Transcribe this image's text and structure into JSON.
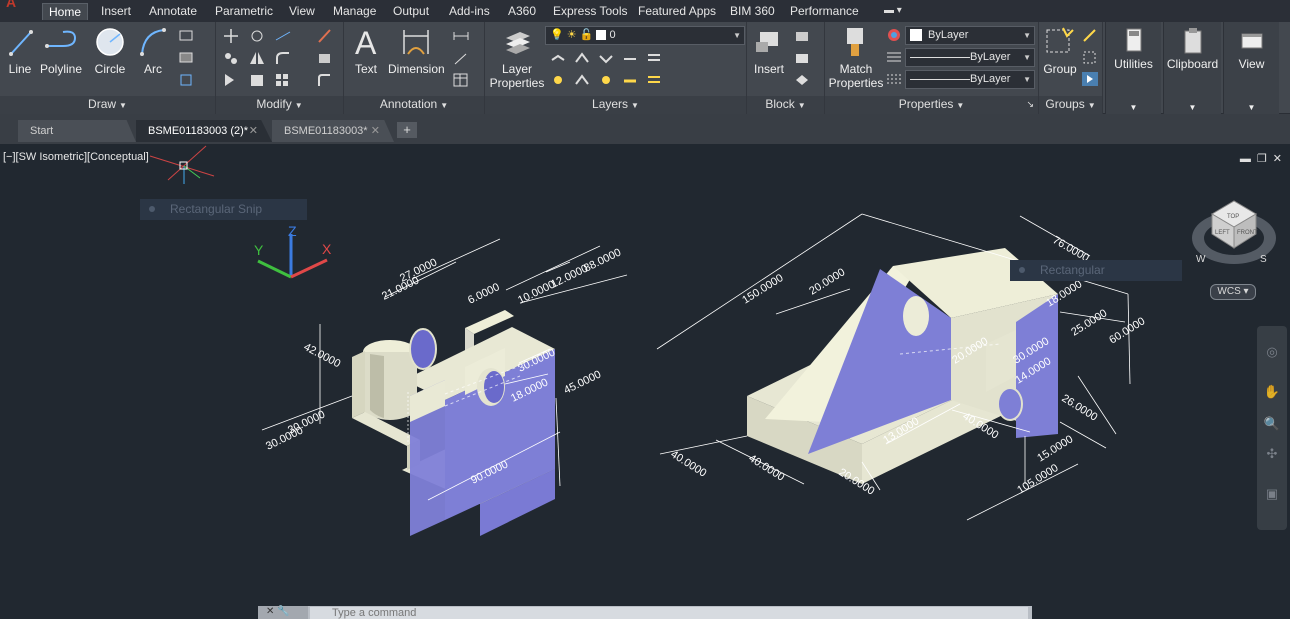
{
  "menubar": {
    "tabs": [
      {
        "label": "Home",
        "active": true
      },
      {
        "label": "Insert"
      },
      {
        "label": "Annotate"
      },
      {
        "label": "Parametric"
      },
      {
        "label": "View"
      },
      {
        "label": "Manage"
      },
      {
        "label": "Output"
      },
      {
        "label": "Add-ins"
      },
      {
        "label": "A360"
      },
      {
        "label": "Express Tools"
      },
      {
        "label": "Featured Apps"
      },
      {
        "label": "BIM 360"
      },
      {
        "label": "Performance"
      }
    ]
  },
  "ribbon": {
    "draw": {
      "title": "Draw",
      "line": "Line",
      "polyline": "Polyline",
      "circle": "Circle",
      "arc": "Arc"
    },
    "modify": {
      "title": "Modify"
    },
    "annotation": {
      "title": "Annotation",
      "text": "Text",
      "dimension": "Dimension"
    },
    "layers": {
      "title": "Layers",
      "layer_properties_1": "Layer",
      "layer_properties_2": "Properties",
      "current_layer": "0"
    },
    "block": {
      "title": "Block",
      "insert": "Insert"
    },
    "properties": {
      "title": "Properties",
      "match_1": "Match",
      "match_2": "Properties",
      "color": "ByLayer",
      "linetype": "ByLayer",
      "lineweight": "ByLayer"
    },
    "groups": {
      "title": "Groups",
      "group": "Group"
    },
    "utilities": "Utilities",
    "clipboard": "Clipboard",
    "view": "View"
  },
  "filetabs": {
    "tabs": [
      {
        "label": "Start"
      },
      {
        "label": "BSME01183003 (2)*",
        "active": true
      },
      {
        "label": "BSME01183003*"
      }
    ],
    "new_tab": "+"
  },
  "viewport": {
    "label": "[−][SW Isometric][Conceptual]",
    "snip_tip_1": "Rectangular Snip",
    "snip_tip_2": "Rectangular",
    "wcs": "WCS",
    "viewcube": {
      "top": "TOP",
      "left": "LEFT",
      "front": "FRONT",
      "w": "W",
      "s": "S"
    },
    "ucs": {
      "x": "X",
      "y": "Y",
      "z": "Z"
    }
  },
  "drawing": {
    "left_part": [
      "27.0000",
      "21.0000",
      "6.0000",
      "10.0000",
      "12.0000",
      "88.0000",
      "42.0000",
      "30.0000",
      "45.0000",
      "18.0000",
      "30.0000",
      "30.0000",
      "90.0000"
    ],
    "right_part": [
      "150.0000",
      "76.0000",
      "20.0000",
      "18.0000",
      "25.0000",
      "60.0000",
      "20.0000",
      "30.0000",
      "14.0000",
      "26.0000",
      "40.0000",
      "13.0000",
      "40.0000",
      "40.0000",
      "20.0000",
      "15.0000",
      "105.0000"
    ]
  },
  "command": {
    "placeholder": "Type a command"
  }
}
